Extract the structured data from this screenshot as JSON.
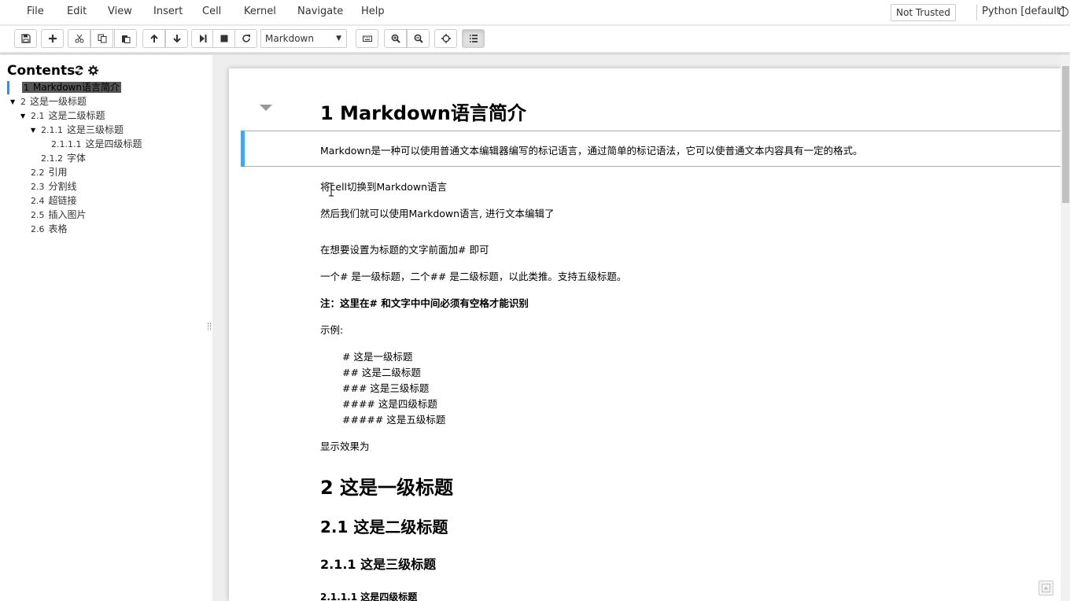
{
  "menu": [
    "File",
    "Edit",
    "View",
    "Insert",
    "Cell",
    "Kernel",
    "Navigate",
    "Help"
  ],
  "header": {
    "trust_label": "Not Trusted",
    "kernel_label": "Python [default]"
  },
  "toolbar": {
    "cell_type": "Markdown"
  },
  "toc": {
    "title": "Contents",
    "items": [
      {
        "num": "1",
        "label": "Markdown语言简介"
      },
      {
        "num": "2",
        "label": "这是一级标题"
      },
      {
        "num": "2.1",
        "label": "这是二级标题"
      },
      {
        "num": "2.1.1",
        "label": "这是三级标题"
      },
      {
        "num": "2.1.1.1",
        "label": "这是四级标题"
      },
      {
        "num": "2.1.2",
        "label": "字体"
      },
      {
        "num": "2.2",
        "label": "引用"
      },
      {
        "num": "2.3",
        "label": "分割线"
      },
      {
        "num": "2.4",
        "label": "超链接"
      },
      {
        "num": "2.5",
        "label": "插入图片"
      },
      {
        "num": "2.6",
        "label": "表格"
      }
    ]
  },
  "notebook": {
    "h1_main": "1  Markdown语言简介",
    "intro": "Markdown是一种可以使用普通文本编辑器编写的标记语言，通过简单的标记语法，它可以使普通文本内容具有一定的格式。",
    "p1": "将cell切换到Markdown语言",
    "p2": "然后我们就可以使用Markdown语言, 进行文本编辑了",
    "p3": "在想要设置为标题的文字前面加# 即可",
    "p4": "一个# 是一级标题，二个## 是二级标题，以此类推。支持五级标题。",
    "p5": "注：这里在# 和文字中中间必须有空格才能识别",
    "p6": "示例:",
    "code": [
      "# 这是一级标题",
      "## 这是二级标题",
      "### 这是三级标题",
      "#### 这是四级标题",
      "##### 这是五级标题"
    ],
    "p7": "显示效果为",
    "h_level1": "2  这是一级标题",
    "h_level2": "2.1  这是二级标题",
    "h_level3": "2.1.1  这是三级标题",
    "h_level4": "2.1.1.1  这是四级标题"
  }
}
